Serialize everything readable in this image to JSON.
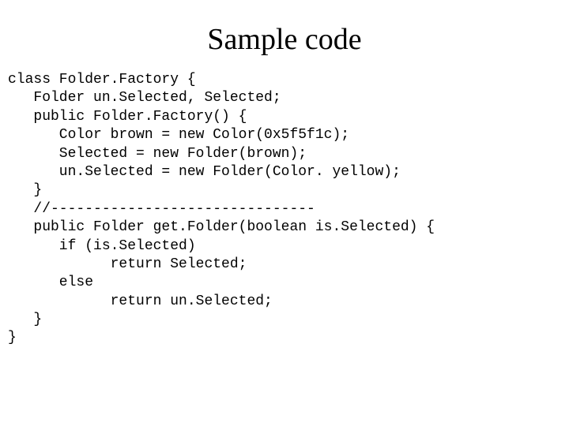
{
  "title": "Sample code",
  "code": {
    "l1": "class Folder.Factory {",
    "l2": "   Folder un.Selected, Selected;",
    "l3": "   public Folder.Factory() {",
    "l4": "      Color brown = new Color(0x5f5f1c);",
    "l5": "      Selected = new Folder(brown);",
    "l6": "      un.Selected = new Folder(Color. yellow);",
    "l7": "   }",
    "l8": "   //-------------------------------",
    "l9": "   public Folder get.Folder(boolean is.Selected) {",
    "l10": "      if (is.Selected)",
    "l11": "            return Selected;",
    "l12": "      else",
    "l13": "            return un.Selected;",
    "l14": "   }",
    "l15": "}"
  }
}
